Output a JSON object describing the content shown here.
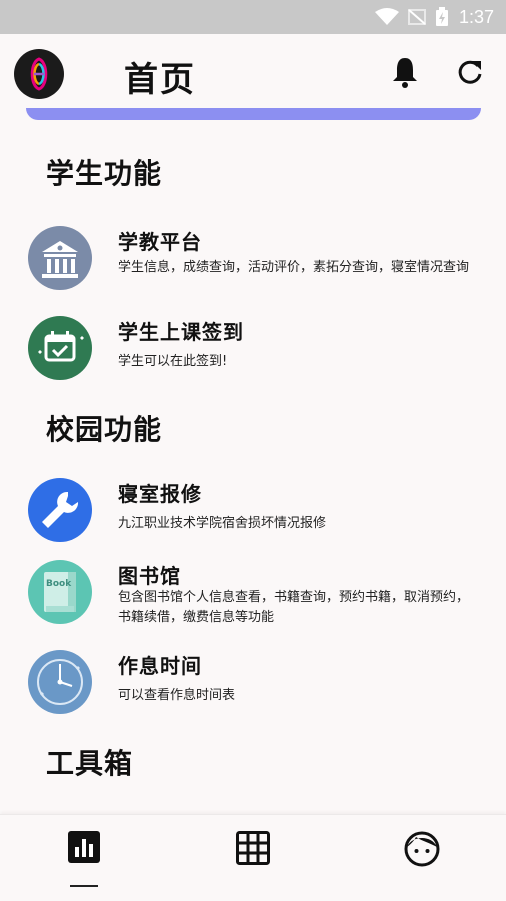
{
  "status_bar": {
    "time": "1:37"
  },
  "header": {
    "title": "首页"
  },
  "sections": {
    "student": {
      "title": "学生功能",
      "items": [
        {
          "title": "学教平台",
          "subtitle": "学生信息，成绩查询，活动评价，素拓分查询，寝室情况查询"
        },
        {
          "title": "学生上课签到",
          "subtitle": "学生可以在此签到!"
        }
      ]
    },
    "campus": {
      "title": "校园功能",
      "items": [
        {
          "title": "寝室报修",
          "subtitle": "九江职业技术学院宿舍损坏情况报修"
        },
        {
          "title": "图书馆",
          "subtitle": "包含图书馆个人信息查看，书籍查询，预约书籍，取消预约，",
          "subtitle2": "书籍续借，缴费信息等功能"
        },
        {
          "title": "作息时间",
          "subtitle": "可以查看作息时间表"
        }
      ]
    },
    "tools": {
      "title": "工具箱"
    }
  },
  "icons": {
    "platform": "bank-building-icon",
    "checkin": "calendar-check-icon",
    "repair": "wrench-icon",
    "library": "book-icon",
    "schedule": "clock-icon"
  },
  "colors": {
    "accent": "#8c8ff1",
    "platform_bg": "#7b8ba8",
    "checkin_bg": "#2f7a52",
    "repair_bg": "#2f6ee6",
    "library_bg": "#5cc5b3",
    "schedule_bg": "#6a98c7"
  }
}
